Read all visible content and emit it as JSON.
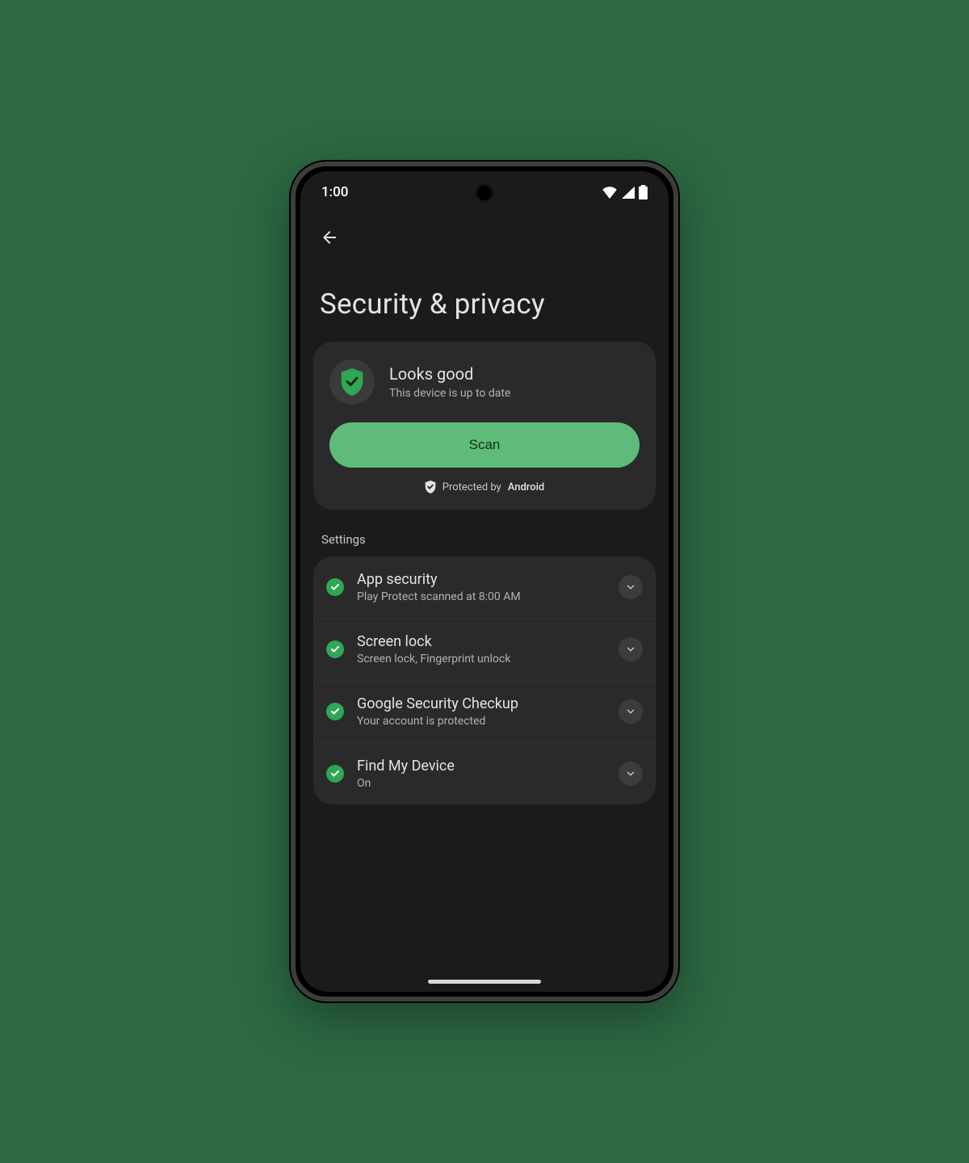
{
  "status": {
    "time": "1:00"
  },
  "page": {
    "title": "Security & privacy"
  },
  "card": {
    "title": "Looks good",
    "subtitle": "This device is up to date",
    "scan_label": "Scan",
    "protected_prefix": "Protected by",
    "protected_os": "Android"
  },
  "colors": {
    "accent": "#5fbb7a",
    "ok": "#2fa755"
  },
  "section_label": "Settings",
  "rows": [
    {
      "title": "App security",
      "subtitle": "Play Protect scanned at 8:00 AM"
    },
    {
      "title": "Screen lock",
      "subtitle": "Screen lock, Fingerprint unlock"
    },
    {
      "title": "Google Security Checkup",
      "subtitle": "Your account is protected"
    },
    {
      "title": "Find My Device",
      "subtitle": "On"
    }
  ]
}
